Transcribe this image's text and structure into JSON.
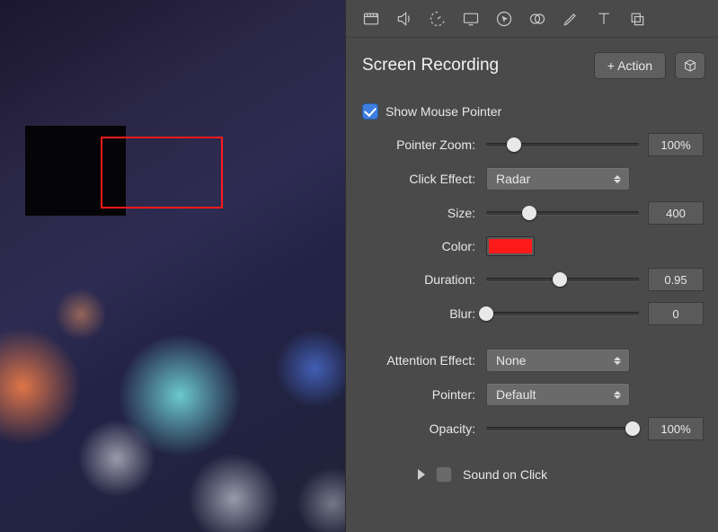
{
  "panel": {
    "title": "Screen Recording",
    "add_action_label": "+ Action"
  },
  "show_mouse": {
    "label": "Show Mouse Pointer",
    "checked": true
  },
  "pointer_zoom": {
    "label": "Pointer Zoom:",
    "value": "100%",
    "thumb_pct": 18
  },
  "click_effect": {
    "label": "Click Effect:",
    "selected": "Radar"
  },
  "size": {
    "label": "Size:",
    "value": "400",
    "thumb_pct": 28
  },
  "color": {
    "label": "Color:",
    "hex": "#ff1a1a"
  },
  "duration": {
    "label": "Duration:",
    "value": "0.95",
    "thumb_pct": 48
  },
  "blur": {
    "label": "Blur:",
    "value": "0",
    "thumb_pct": 0
  },
  "attention_effect": {
    "label": "Attention Effect:",
    "selected": "None"
  },
  "pointer": {
    "label": "Pointer:",
    "selected": "Default"
  },
  "opacity": {
    "label": "Opacity:",
    "value": "100%",
    "thumb_pct": 96
  },
  "sound_on_click": {
    "label": "Sound on Click",
    "checked": false
  }
}
